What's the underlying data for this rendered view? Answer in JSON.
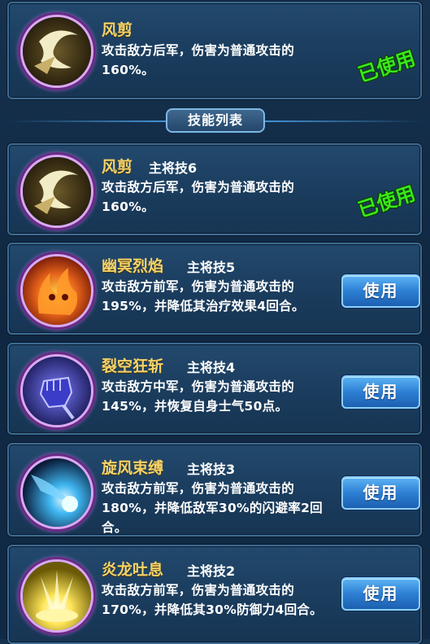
{
  "current_skill": {
    "name": "风剪",
    "desc": "攻击敌方后军，伤害为普通攻击的160%。",
    "status": "已使用",
    "icon": "wind-slash-icon"
  },
  "section_title": "技能列表",
  "skills": [
    {
      "name": "风剪",
      "level": "主将技6",
      "desc": "攻击敌方后军，伤害为普通攻击的160%。",
      "status": "已使用",
      "icon": "wind-slash-icon"
    },
    {
      "name": "幽冥烈焰",
      "level": "主将技5",
      "desc": "攻击敌方前军，伤害为普通攻击的195%，并降低其治疗效果4回合。",
      "button": "使用",
      "icon": "flame-face-icon"
    },
    {
      "name": "裂空狂斩",
      "level": "主将技4",
      "desc": "攻击敌方中军，伤害为普通攻击的145%，并恢复自身士气50点。",
      "button": "使用",
      "icon": "fist-icon"
    },
    {
      "name": "旋风束缚",
      "level": "主将技3",
      "desc": "攻击敌方前军，伤害为普通攻击的180%，并降低敌军30%的闪避率2回合。",
      "button": "使用",
      "icon": "blue-comet-icon"
    },
    {
      "name": "炎龙吐息",
      "level": "主将技2",
      "desc": "攻击敌方前军，伤害为普通攻击的170%，并降低其30%防御力4回合。",
      "button": "使用",
      "icon": "light-burst-icon"
    }
  ]
}
